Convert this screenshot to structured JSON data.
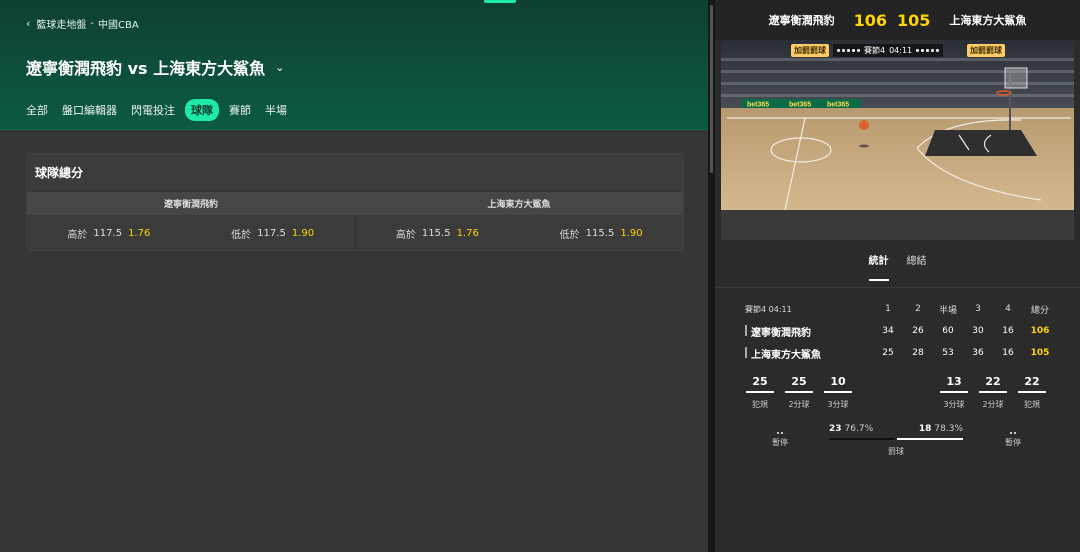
{
  "breadcrumb": {
    "section": "籃球走地盤",
    "separator": "-",
    "league": "中國CBA"
  },
  "match": {
    "title": "遼寧衡潤飛豹 vs 上海東方大鯊魚"
  },
  "tabs": [
    "全部",
    "盤口編輯器",
    "閃電投注",
    "球隊",
    "賽節",
    "半場"
  ],
  "active_tab": "球隊",
  "market": {
    "title": "球隊總分",
    "teams": [
      "遼寧衡潤飛豹",
      "上海東方大鯊魚"
    ],
    "odds": [
      {
        "label": "高於",
        "line": "117.5",
        "price": "1.76"
      },
      {
        "label": "低於",
        "line": "117.5",
        "price": "1.90"
      },
      {
        "label": "高於",
        "line": "115.5",
        "price": "1.76"
      },
      {
        "label": "低於",
        "line": "115.5",
        "price": "1.90"
      }
    ]
  },
  "scoreboard": {
    "home": "遼寧衡潤飛豹",
    "home_score": "106",
    "away_score": "105",
    "away": "上海東方大鯊魚"
  },
  "court": {
    "left_badge": "加罰罰球",
    "right_badge": "加罰罰球",
    "period": "賽節4",
    "clock": "04:11",
    "ad_text": "bet365"
  },
  "stats_tabs": [
    "統計",
    "總結"
  ],
  "grid": {
    "period_label": "賽節4",
    "clock": "04:11",
    "headers": [
      "1",
      "2",
      "半場",
      "3",
      "4",
      "總分"
    ],
    "rows": [
      {
        "team": "遼寧衡潤飛豹",
        "values": [
          "34",
          "26",
          "60",
          "30",
          "16",
          "106"
        ]
      },
      {
        "team": "上海東方大鯊魚",
        "values": [
          "25",
          "28",
          "53",
          "36",
          "16",
          "105"
        ]
      }
    ]
  },
  "team_stats": {
    "home": [
      {
        "value": "25",
        "label": "犯規"
      },
      {
        "value": "25",
        "label": "2分球"
      },
      {
        "value": "10",
        "label": "3分球"
      }
    ],
    "away": [
      {
        "value": "13",
        "label": "3分球"
      },
      {
        "value": "22",
        "label": "2分球"
      },
      {
        "value": "22",
        "label": "犯規"
      }
    ]
  },
  "timeouts": {
    "label": "暫停"
  },
  "free_throws": {
    "home_made": "23",
    "home_pct": "76.7%",
    "away_made": "18",
    "away_pct": "78.3%",
    "label": "罰球"
  },
  "colors": {
    "accent": "#1de9a8",
    "score": "#ffd400",
    "header_dark": "#0f3f33"
  }
}
